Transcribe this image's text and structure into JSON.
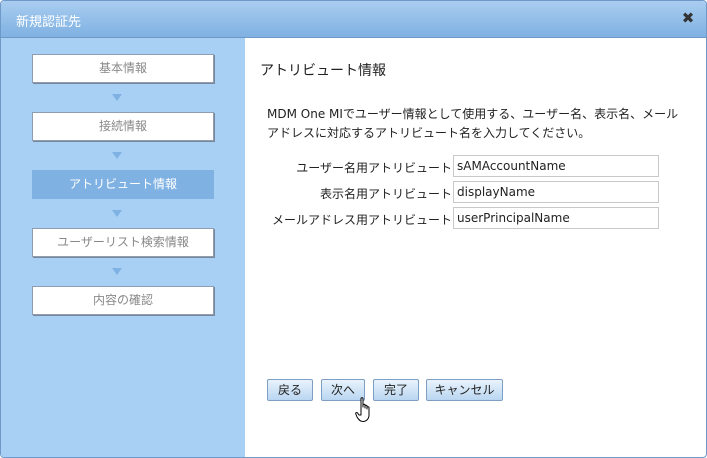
{
  "window": {
    "title": "新規認証先"
  },
  "steps": [
    {
      "label": "基本情報",
      "active": false
    },
    {
      "label": "接続情報",
      "active": false
    },
    {
      "label": "アトリビュート情報",
      "active": true
    },
    {
      "label": "ユーザーリスト検索情報",
      "active": false
    },
    {
      "label": "内容の確認",
      "active": false
    }
  ],
  "section": {
    "title": "アトリビュート情報",
    "description_line1": "MDM One MIでユーザー情報として使用する、ユーザー名、表示名、メール",
    "description_line2": "アドレスに対応するアトリビュート名を入力してください。"
  },
  "fields": {
    "username": {
      "label": "ユーザー名用アトリビュート",
      "value": "sAMAccountName"
    },
    "displayname": {
      "label": "表示名用アトリビュート",
      "value": "displayName"
    },
    "email": {
      "label": "メールアドレス用アトリビュート",
      "value": "userPrincipalName"
    }
  },
  "buttons": {
    "back": "戻る",
    "next": "次へ",
    "finish": "完了",
    "cancel": "キャンセル"
  },
  "icons": {
    "close": "close-icon",
    "cursor": "hand-pointer-icon"
  },
  "colors": {
    "titlebar": "#8fbfea",
    "sidebar": "#a8d0f4",
    "active_step": "#7fb2e3",
    "button": "#cfe2f6"
  }
}
